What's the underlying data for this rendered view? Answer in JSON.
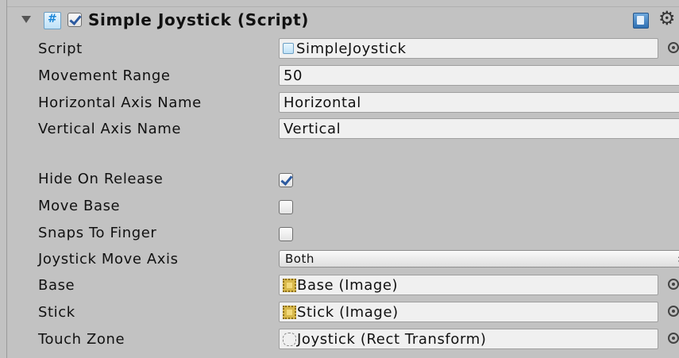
{
  "component": {
    "title": "Simple Joystick (Script)",
    "enabled": true
  },
  "fields": {
    "script": {
      "label": "Script",
      "value": "SimpleJoystick"
    },
    "movement_range": {
      "label": "Movement Range",
      "value": "50"
    },
    "horizontal_axis_name": {
      "label": "Horizontal Axis Name",
      "value": "Horizontal"
    },
    "vertical_axis_name": {
      "label": "Vertical Axis Name",
      "value": "Vertical"
    },
    "hide_on_release": {
      "label": "Hide On Release",
      "checked": true
    },
    "move_base": {
      "label": "Move Base",
      "checked": false
    },
    "snaps_to_finger": {
      "label": "Snaps To Finger",
      "checked": false
    },
    "joystick_move_axis": {
      "label": "Joystick Move Axis",
      "value": "Both"
    },
    "base": {
      "label": "Base",
      "value": "Base (Image)"
    },
    "stick": {
      "label": "Stick",
      "value": "Stick (Image)"
    },
    "touch_zone": {
      "label": "Touch Zone",
      "value": "Joystick (Rect Transform)"
    }
  },
  "icons": {
    "foldout": "triangle-down-icon",
    "component": "script-icon",
    "help": "help-book-icon",
    "settings": "gear-icon",
    "object_picker": "object-picker-icon",
    "dropdown_arrow": "up-down-arrow-icon"
  },
  "colors": {
    "background": "#c2c2c2",
    "field": "#f0f0f0",
    "check": "#2c5aa0"
  }
}
